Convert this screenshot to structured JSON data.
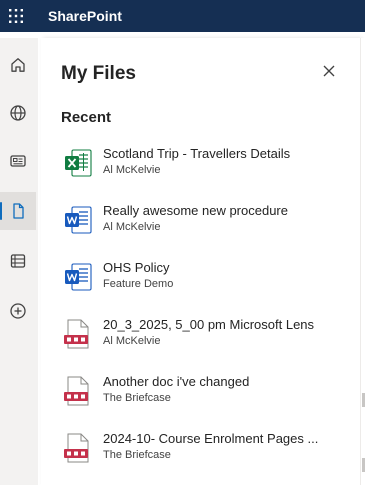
{
  "app": {
    "name": "SharePoint"
  },
  "panel": {
    "title": "My Files",
    "section_heading": "Recent"
  },
  "files": [
    {
      "name": "Scotland Trip - Travellers Details",
      "location": "Al McKelvie",
      "type": "excel-icon"
    },
    {
      "name": "Really awesome new procedure",
      "location": "Al McKelvie",
      "type": "word-icon"
    },
    {
      "name": "OHS Policy",
      "location": "Feature Demo",
      "type": "word-icon"
    },
    {
      "name": "20_3_2025, 5_00 pm Microsoft Lens",
      "location": "Al McKelvie",
      "type": "pdf-icon"
    },
    {
      "name": "Another doc i've changed",
      "location": "The Briefcase",
      "type": "pdf-icon"
    },
    {
      "name": "2024-10- Course Enrolment Pages ...",
      "location": "The Briefcase",
      "type": "pdf-icon"
    }
  ],
  "rail_icons": [
    "home-icon",
    "globe-icon",
    "news-icon",
    "file-icon",
    "lists-icon",
    "add-icon"
  ],
  "colors": {
    "topbar": "#152f53",
    "accent": "#0f6cbd",
    "excel": "#107c41",
    "word": "#185abd",
    "pdf": "#c4314b"
  }
}
